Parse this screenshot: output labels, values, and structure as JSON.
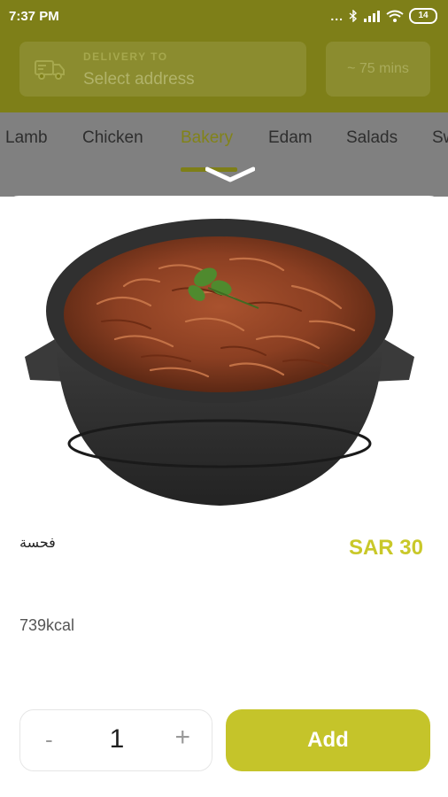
{
  "status_bar": {
    "time": "7:37 PM",
    "dots": "...",
    "battery": "14"
  },
  "header": {
    "delivery_label": "DELIVERY TO",
    "delivery_value": "Select address",
    "eta": "~ 75 mins"
  },
  "categories": {
    "items": [
      "Lamb",
      "Chicken",
      "Bakery",
      "Edam",
      "Salads",
      "Sw"
    ],
    "active": "Bakery"
  },
  "product": {
    "name": "فحسة",
    "price": "SAR 30",
    "calories": "739kcal",
    "quantity": "1",
    "minus_label": "-",
    "plus_label": "+",
    "add_label": "Add"
  },
  "colors": {
    "accent": "#c5c42a",
    "header_bg": "#7e7f18"
  }
}
